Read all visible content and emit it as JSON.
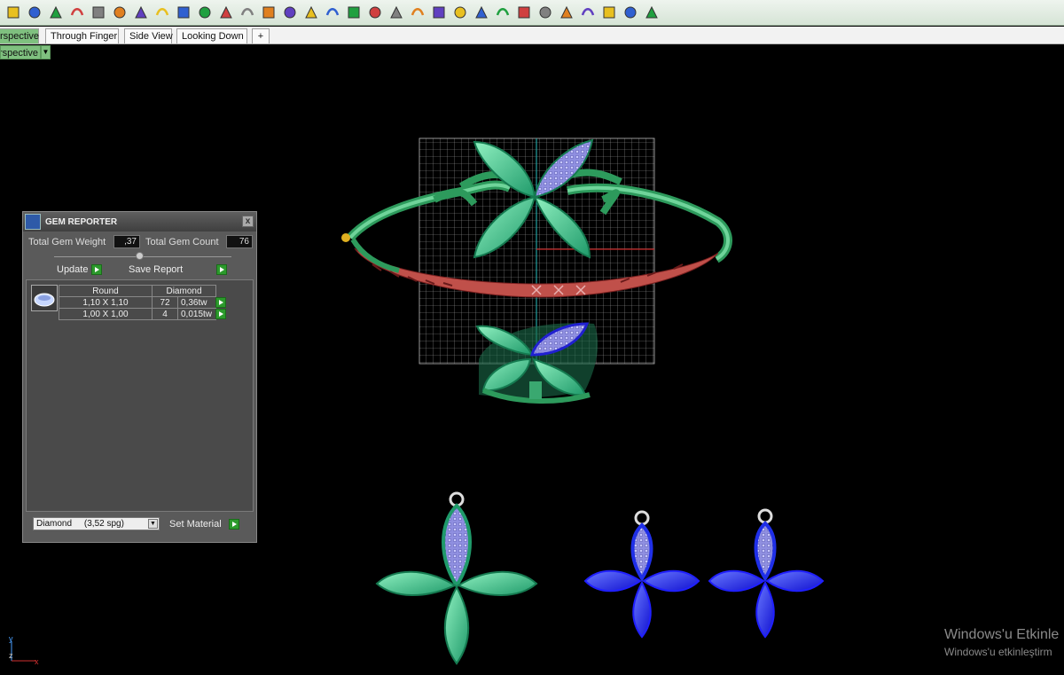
{
  "toolbar": {
    "icons": [
      "select-icon",
      "paint-icon",
      "box-icon",
      "curve-icon",
      "pen-icon",
      "rect-icon",
      "cube-icon",
      "color-wheel-icon",
      "brush-icon",
      "nodes-icon",
      "pattern-icon",
      "ring-icon",
      "flag-icon",
      "gem-icon",
      "magic-icon",
      "chain-icon",
      "sphere-icon",
      "box2-icon",
      "pencil-icon",
      "grid-icon",
      "spiral-icon",
      "gear-icon",
      "wave-icon",
      "edit-icon",
      "circle-icon",
      "view-cube-icon",
      "coin-icon",
      "tools-icon",
      "brush2-icon",
      "zoom-icon",
      "funnel-icon"
    ]
  },
  "tabs": [
    "rspective",
    "Through Finger",
    "Side View",
    "Looking Down",
    "+"
  ],
  "viewport": {
    "label": "rspective"
  },
  "gem_reporter": {
    "title": "GEM REPORTER",
    "close": "x",
    "total_weight_label": "Total Gem Weight",
    "total_weight_value": ",37",
    "total_count_label": "Total Gem Count",
    "total_count_value": "76",
    "update_label": "Update",
    "save_report_label": "Save Report",
    "table": {
      "cut": "Round",
      "material": "Diamond",
      "rows": [
        {
          "size": "1,10 X 1,10",
          "count": "72",
          "weight": "0,36tw"
        },
        {
          "size": "1,00 X 1,00",
          "count": "4",
          "weight": "0,015tw"
        }
      ]
    },
    "material_select": "Diamond     (3,52 spg)",
    "set_material_label": "Set Material"
  },
  "axes": {
    "y": "y",
    "z": "z",
    "x": "x"
  },
  "watermark": {
    "line1": "Windows'u Etkinle",
    "line2": "Windows'u etkinleştirm"
  },
  "colors": {
    "accent": "#7fc07f",
    "gem_green": "#3dbf8a",
    "gem_blue": "#1f2fe8",
    "band_red": "#c0504a"
  }
}
